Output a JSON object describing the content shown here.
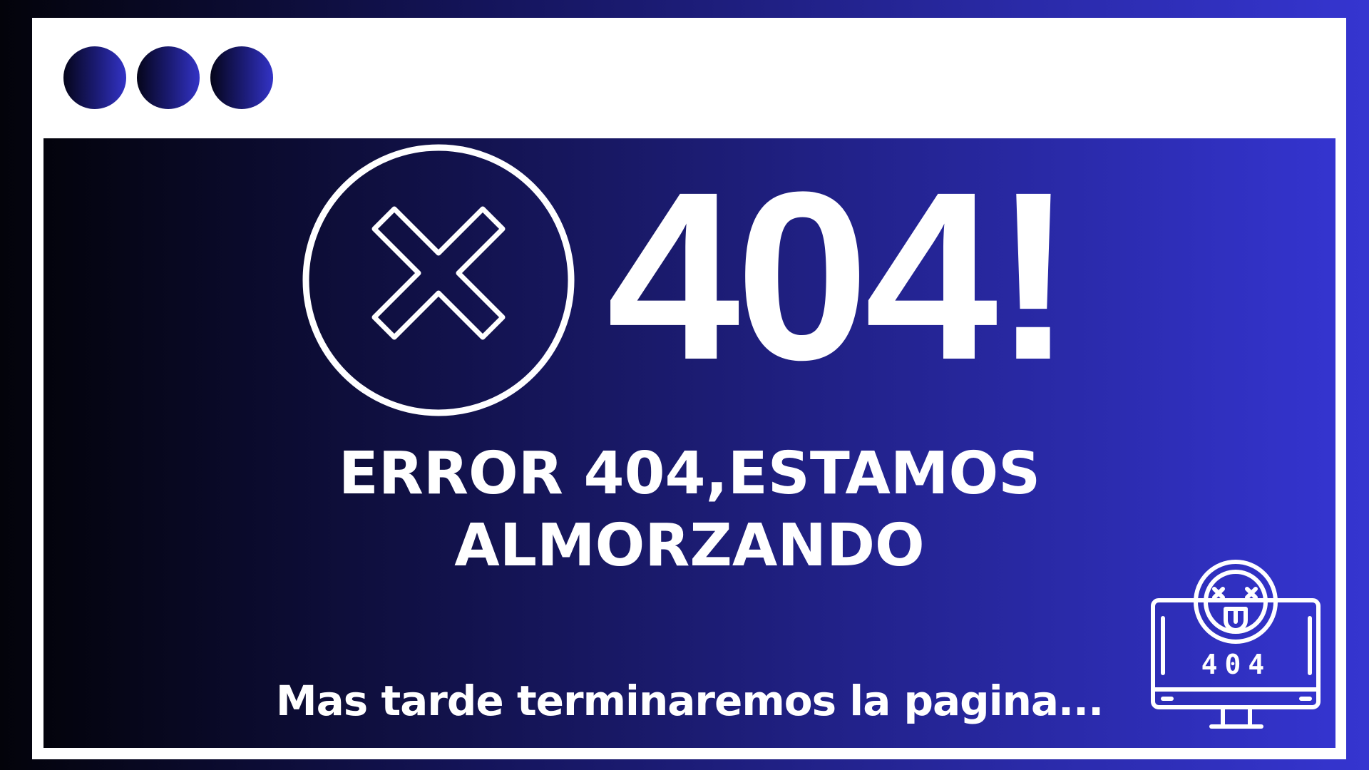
{
  "window": {
    "controls": [
      "window-dot",
      "window-dot",
      "window-dot"
    ]
  },
  "error": {
    "code": "404!",
    "headline_line1": "ERROR 404,ESTAMOS",
    "headline_line2": "ALMORZANDO",
    "message": "Mas tarde terminaremos la pagina...",
    "icon": "close-circle-icon"
  },
  "illustration": {
    "icon": "broken-monitor-icon",
    "label": "404"
  },
  "colors": {
    "background_dark": "#03030a",
    "background_accent": "#3535d0",
    "window_frame": "#ffffff",
    "text": "#ffffff"
  }
}
